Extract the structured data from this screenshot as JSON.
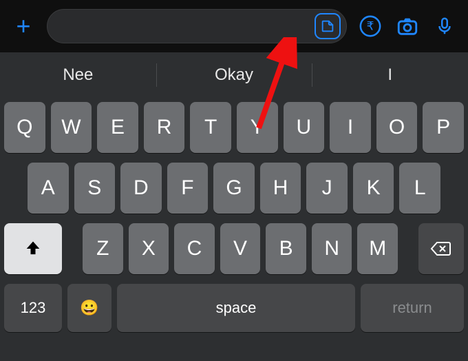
{
  "topbar": {
    "plus_label": "+",
    "input_placeholder": ""
  },
  "suggestions": [
    "Nee",
    "Okay",
    "I"
  ],
  "keyboard": {
    "row1": [
      "Q",
      "W",
      "E",
      "R",
      "T",
      "Y",
      "U",
      "I",
      "O",
      "P"
    ],
    "row2": [
      "A",
      "S",
      "D",
      "F",
      "G",
      "H",
      "J",
      "K",
      "L"
    ],
    "row3": [
      "Z",
      "X",
      "C",
      "V",
      "B",
      "N",
      "M"
    ],
    "numbers_label": "123",
    "emoji_label": "😀",
    "space_label": "space",
    "return_label": "return"
  },
  "icons": {
    "sticker": "sticker-icon",
    "rupee": "rupee-icon",
    "camera": "camera-icon",
    "mic": "mic-icon",
    "shift": "shift-icon",
    "backspace": "backspace-icon"
  },
  "accent_color": "#1f86ff"
}
